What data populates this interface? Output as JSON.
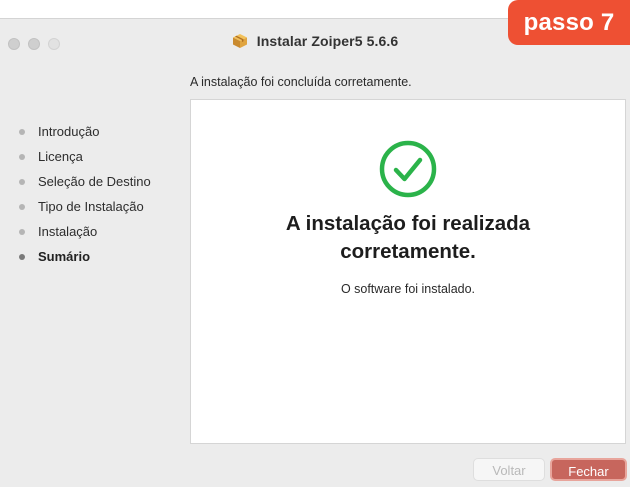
{
  "window": {
    "title": "Instalar Zoiper5 5.6.6"
  },
  "badge": {
    "label": "passo 7"
  },
  "subtitle": "A instalação foi concluída corretamente.",
  "sidebar": {
    "items": [
      {
        "label": "Introdução",
        "active": false
      },
      {
        "label": "Licença",
        "active": false
      },
      {
        "label": "Seleção de Destino",
        "active": false
      },
      {
        "label": "Tipo de Instalação",
        "active": false
      },
      {
        "label": "Instalação",
        "active": false
      },
      {
        "label": "Sumário",
        "active": true
      }
    ]
  },
  "content": {
    "icon": "checkmark-circle-icon",
    "heading_line1": "A instalação foi realizada",
    "heading_line2": "corretamente.",
    "message": "O software foi instalado."
  },
  "buttons": {
    "back_label": "Voltar",
    "close_label": "Fechar"
  },
  "colors": {
    "badge": "#ee5033",
    "check": "#2bb34a",
    "primary_button": "#c7665d"
  }
}
